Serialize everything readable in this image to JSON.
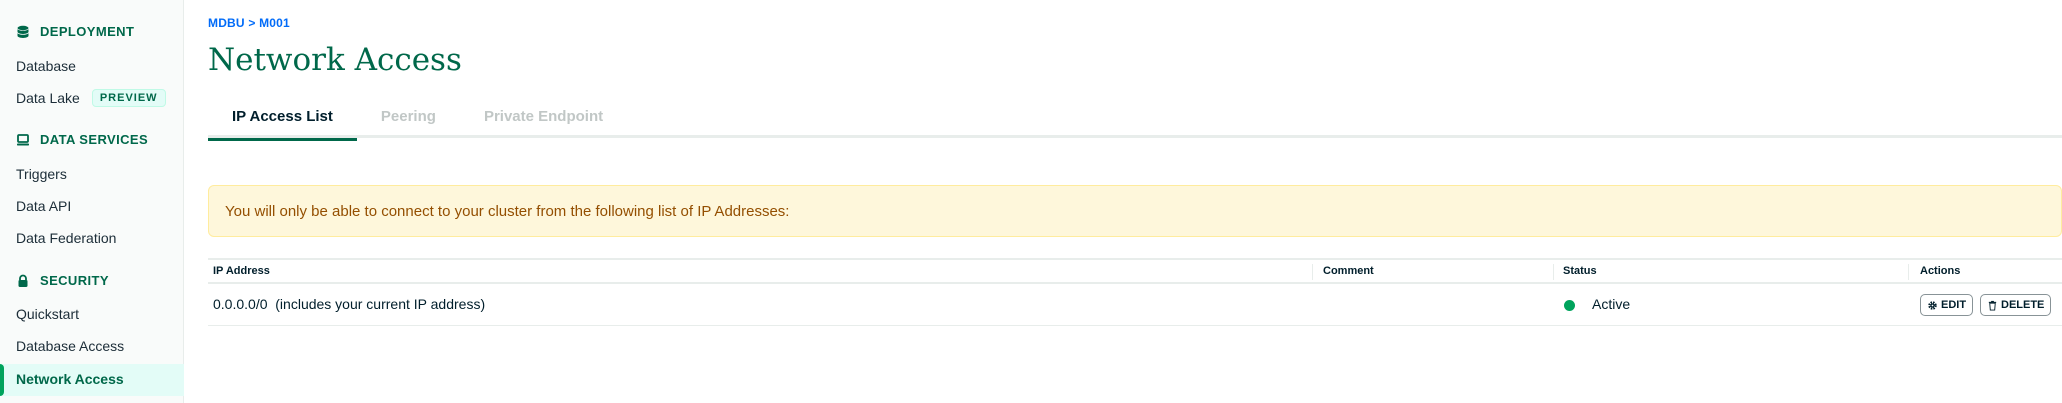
{
  "sidebar": {
    "sections": [
      {
        "title": "DEPLOYMENT",
        "icon": "database-icon"
      },
      {
        "title": "DATA SERVICES",
        "icon": "laptop-icon"
      },
      {
        "title": "SECURITY",
        "icon": "lock-icon"
      }
    ],
    "items": {
      "database": "Database",
      "data_lake": "Data Lake",
      "data_lake_badge": "PREVIEW",
      "triggers": "Triggers",
      "data_api": "Data API",
      "data_federation": "Data Federation",
      "quickstart": "Quickstart",
      "database_access": "Database Access",
      "network_access": "Network Access"
    }
  },
  "header": {
    "breadcrumb": "MDBU > M001",
    "title": "Network Access"
  },
  "tabs": [
    "IP Access List",
    "Peering",
    "Private Endpoint"
  ],
  "banner": "You will only be able to connect to your cluster from the following list of IP Addresses:",
  "table": {
    "columns": [
      "IP Address",
      "Comment",
      "Status",
      "Actions"
    ],
    "rows": [
      {
        "ip": "0.0.0.0/0  (includes your current IP address)",
        "comment": "",
        "status": "Active",
        "edit": "EDIT",
        "delete": "DELETE"
      }
    ]
  },
  "colors": {
    "accent": "#00684a",
    "active_status": "#00a35c",
    "link": "#016bf8",
    "banner_bg": "#fef7db"
  }
}
